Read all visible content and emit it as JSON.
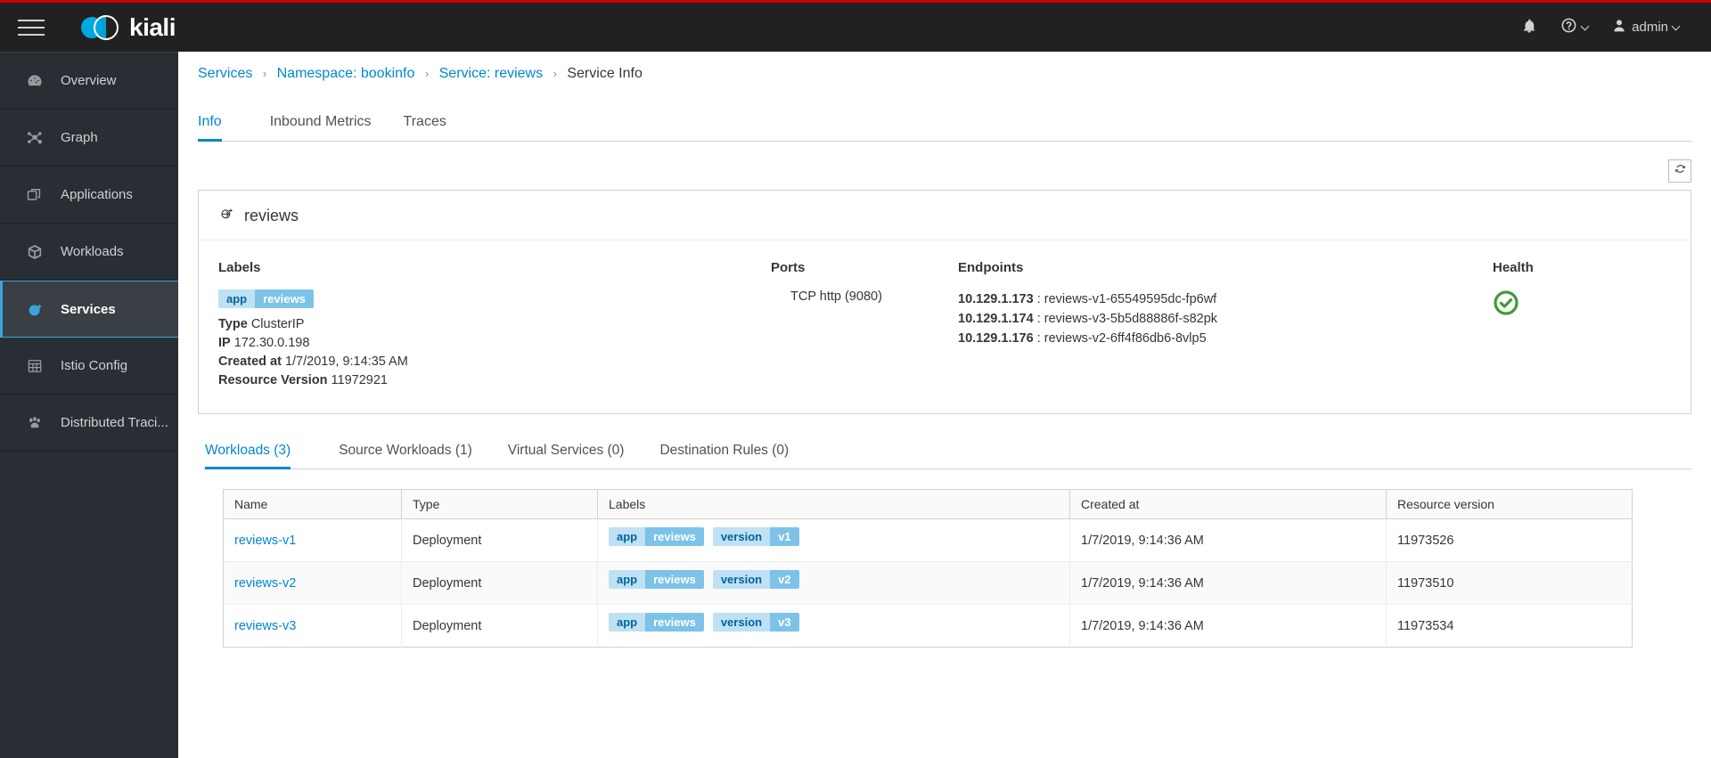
{
  "topbar": {
    "menu_icon": "hamburger-icon",
    "brand": "kiali",
    "notifications_icon": "bell-icon",
    "help_icon": "help-circle-icon",
    "user_icon": "user-icon",
    "user_label": "admin",
    "accent_red": "#c00",
    "brand_blue": "#00a9e0"
  },
  "sidebar": {
    "items": [
      {
        "label": "Overview",
        "icon": "dashboard-icon",
        "active": false
      },
      {
        "label": "Graph",
        "icon": "topology-icon",
        "active": false
      },
      {
        "label": "Applications",
        "icon": "applications-icon",
        "active": false
      },
      {
        "label": "Workloads",
        "icon": "cube-icon",
        "active": false
      },
      {
        "label": "Services",
        "icon": "service-icon",
        "active": true
      },
      {
        "label": "Istio Config",
        "icon": "grid-icon",
        "active": false
      },
      {
        "label": "Distributed Traci...",
        "icon": "paw-icon",
        "active": false
      }
    ],
    "active_color": "#39a5dc"
  },
  "breadcrumb": {
    "items": [
      {
        "label": "Services",
        "link": true
      },
      {
        "label": "Namespace: bookinfo",
        "link": true
      },
      {
        "label": "Service: reviews",
        "link": true
      },
      {
        "label": "Service Info",
        "link": false
      }
    ],
    "separator": "›"
  },
  "tabs": [
    {
      "label": "Info",
      "active": true
    },
    {
      "label": "Inbound Metrics",
      "active": false
    },
    {
      "label": "Traces",
      "active": false
    }
  ],
  "toolbar": {
    "refresh_icon": "refresh-icon"
  },
  "service_card": {
    "icon": "service-icon",
    "title": "reviews",
    "labels": {
      "heading": "Labels",
      "badges": [
        {
          "key": "app",
          "value": "reviews"
        }
      ],
      "details": [
        {
          "key": "Type",
          "value": "ClusterIP"
        },
        {
          "key": "IP",
          "value": "172.30.0.198"
        },
        {
          "key": "Created at",
          "value": "1/7/2019, 9:14:35 AM"
        },
        {
          "key": "Resource Version",
          "value": "11972921"
        }
      ]
    },
    "ports": {
      "heading": "Ports",
      "items": [
        "TCP http (9080)"
      ]
    },
    "endpoints": {
      "heading": "Endpoints",
      "items": [
        {
          "ip": "10.129.1.173",
          "name": "reviews-v1-65549595dc-fp6wf"
        },
        {
          "ip": "10.129.1.174",
          "name": "reviews-v3-5b5d88886f-s82pk"
        },
        {
          "ip": "10.129.1.176",
          "name": "reviews-v2-6ff4f86db6-8vlp5"
        }
      ],
      "separator": ":"
    },
    "health": {
      "heading": "Health",
      "status_icon": "check-circle-icon",
      "status_color": "#3f9c35"
    }
  },
  "subtabs": [
    {
      "label": "Workloads (3)",
      "active": true
    },
    {
      "label": "Source Workloads (1)",
      "active": false
    },
    {
      "label": "Virtual Services (0)",
      "active": false
    },
    {
      "label": "Destination Rules (0)",
      "active": false
    }
  ],
  "workloads_table": {
    "columns": [
      "Name",
      "Type",
      "Labels",
      "Created at",
      "Resource version"
    ],
    "rows": [
      {
        "name": "reviews-v1",
        "type": "Deployment",
        "badges": [
          {
            "key": "app",
            "value": "reviews"
          },
          {
            "key": "version",
            "value": "v1"
          }
        ],
        "created_at": "1/7/2019, 9:14:36 AM",
        "resource_version": "11973526"
      },
      {
        "name": "reviews-v2",
        "type": "Deployment",
        "badges": [
          {
            "key": "app",
            "value": "reviews"
          },
          {
            "key": "version",
            "value": "v2"
          }
        ],
        "created_at": "1/7/2019, 9:14:36 AM",
        "resource_version": "11973510"
      },
      {
        "name": "reviews-v3",
        "type": "Deployment",
        "badges": [
          {
            "key": "app",
            "value": "reviews"
          },
          {
            "key": "version",
            "value": "v3"
          }
        ],
        "created_at": "1/7/2019, 9:14:36 AM",
        "resource_version": "11973534"
      }
    ]
  }
}
